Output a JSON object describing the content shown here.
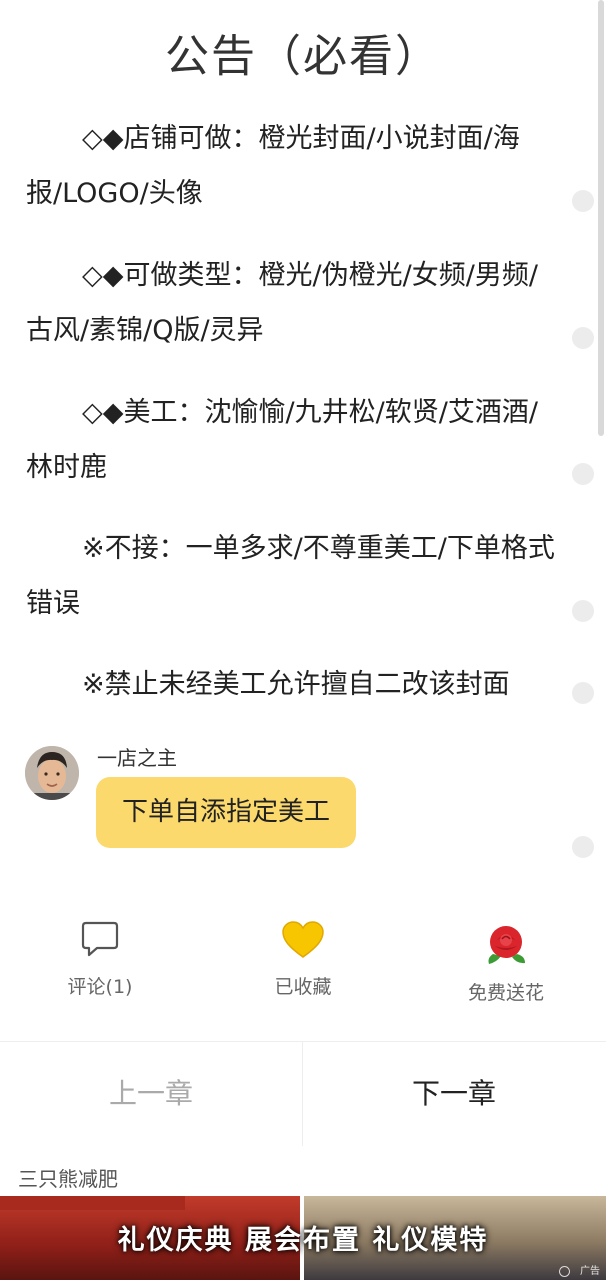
{
  "notice": {
    "title": "公告（必看）",
    "paragraphs": [
      "◇◆店铺可做：橙光封面/小说封面/海报/LOGO/头像",
      "◇◆可做类型：橙光/伪橙光/女频/男频/古风/素锦/Q版/灵异",
      "◇◆美工：沈愉愉/九井松/软贤/艾酒酒/林时鹿",
      "※不接：一单多求/不尊重美工/下单格式错误",
      "※禁止未经美工允许擅自二改该封面"
    ]
  },
  "author_note": {
    "name": "一店之主",
    "message": "下单自添指定美工"
  },
  "actions": {
    "comment_label": "评论(1)",
    "favorite_label": "已收藏",
    "flower_label": "免费送花"
  },
  "chapter_nav": {
    "prev_label": "上一章",
    "next_label": "下一章"
  },
  "ad": {
    "advertiser": "三只熊减肥",
    "banner_text": "礼仪庆典  展会布置  礼仪模特",
    "ad_mark": "广告"
  },
  "colors": {
    "bubble": "#fbd96d",
    "favorite_heart": "#f7c600",
    "flower": "#d9252b"
  },
  "icons": [
    "comment-icon",
    "heart-icon",
    "rose-icon",
    "close-icon"
  ]
}
